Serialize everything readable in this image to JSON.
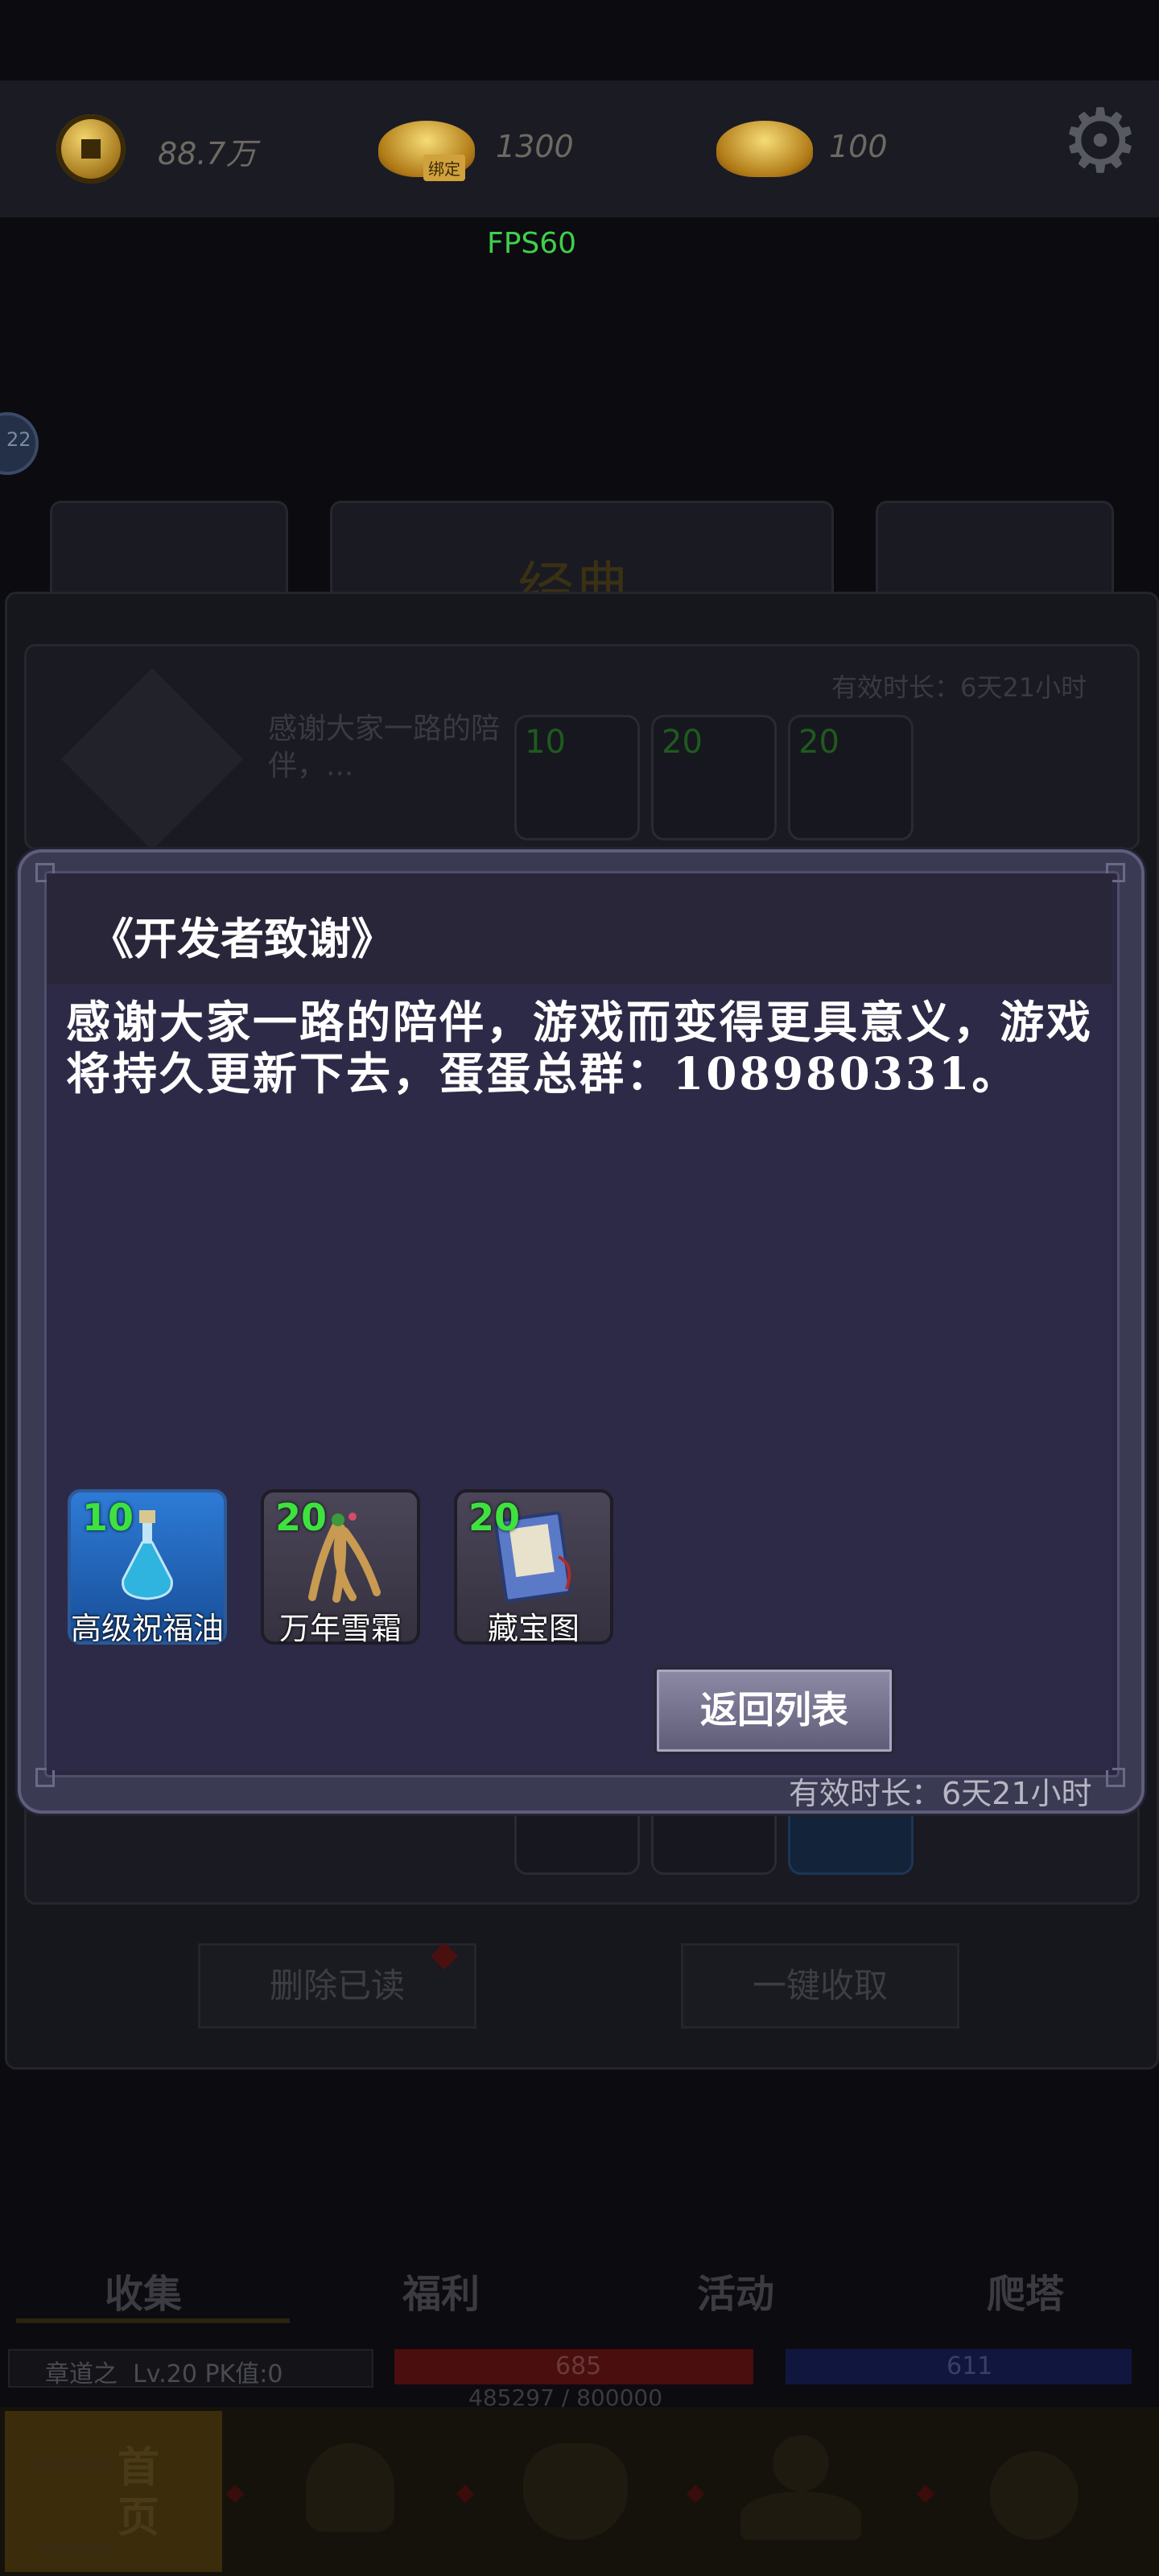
{
  "top_bar": {
    "coins": "88.7万",
    "bound_ingots": "1300",
    "bound_tag": "绑定",
    "ingots": "100",
    "settings_icon": "gear-icon"
  },
  "fps": "FPS60",
  "background": {
    "badge": "22",
    "top_label": "经典",
    "mail_preview": "感谢大家一路的陪伴，...",
    "mail_valid": "有效时长：6天21小时",
    "preview_counts": [
      "10",
      "20",
      "20"
    ],
    "delete_read": "删除已读",
    "collect_all": "一键收取"
  },
  "modal": {
    "title": "《开发者致谢》",
    "body": "感谢大家一路的陪伴，游戏而变得更具意义，游戏将持久更新下去，蛋蛋总群：108980331。",
    "rewards": [
      {
        "count": "10",
        "name": "高级祝福油",
        "icon": "blessing-oil-icon"
      },
      {
        "count": "20",
        "name": "万年雪霜",
        "icon": "ginseng-icon"
      },
      {
        "count": "20",
        "name": "藏宝图",
        "icon": "treasure-map-icon"
      }
    ],
    "return_button": "返回列表",
    "valid_time": "有效时长：6天21小时"
  },
  "tabs": [
    "收集",
    "福利",
    "活动",
    "爬塔"
  ],
  "status": {
    "player": "章道之  Lv.20 PK值:0",
    "hp": "685",
    "mp": "611",
    "exp": "485297 / 800000"
  },
  "nav": {
    "home": "首页",
    "home_label": "首 页"
  }
}
